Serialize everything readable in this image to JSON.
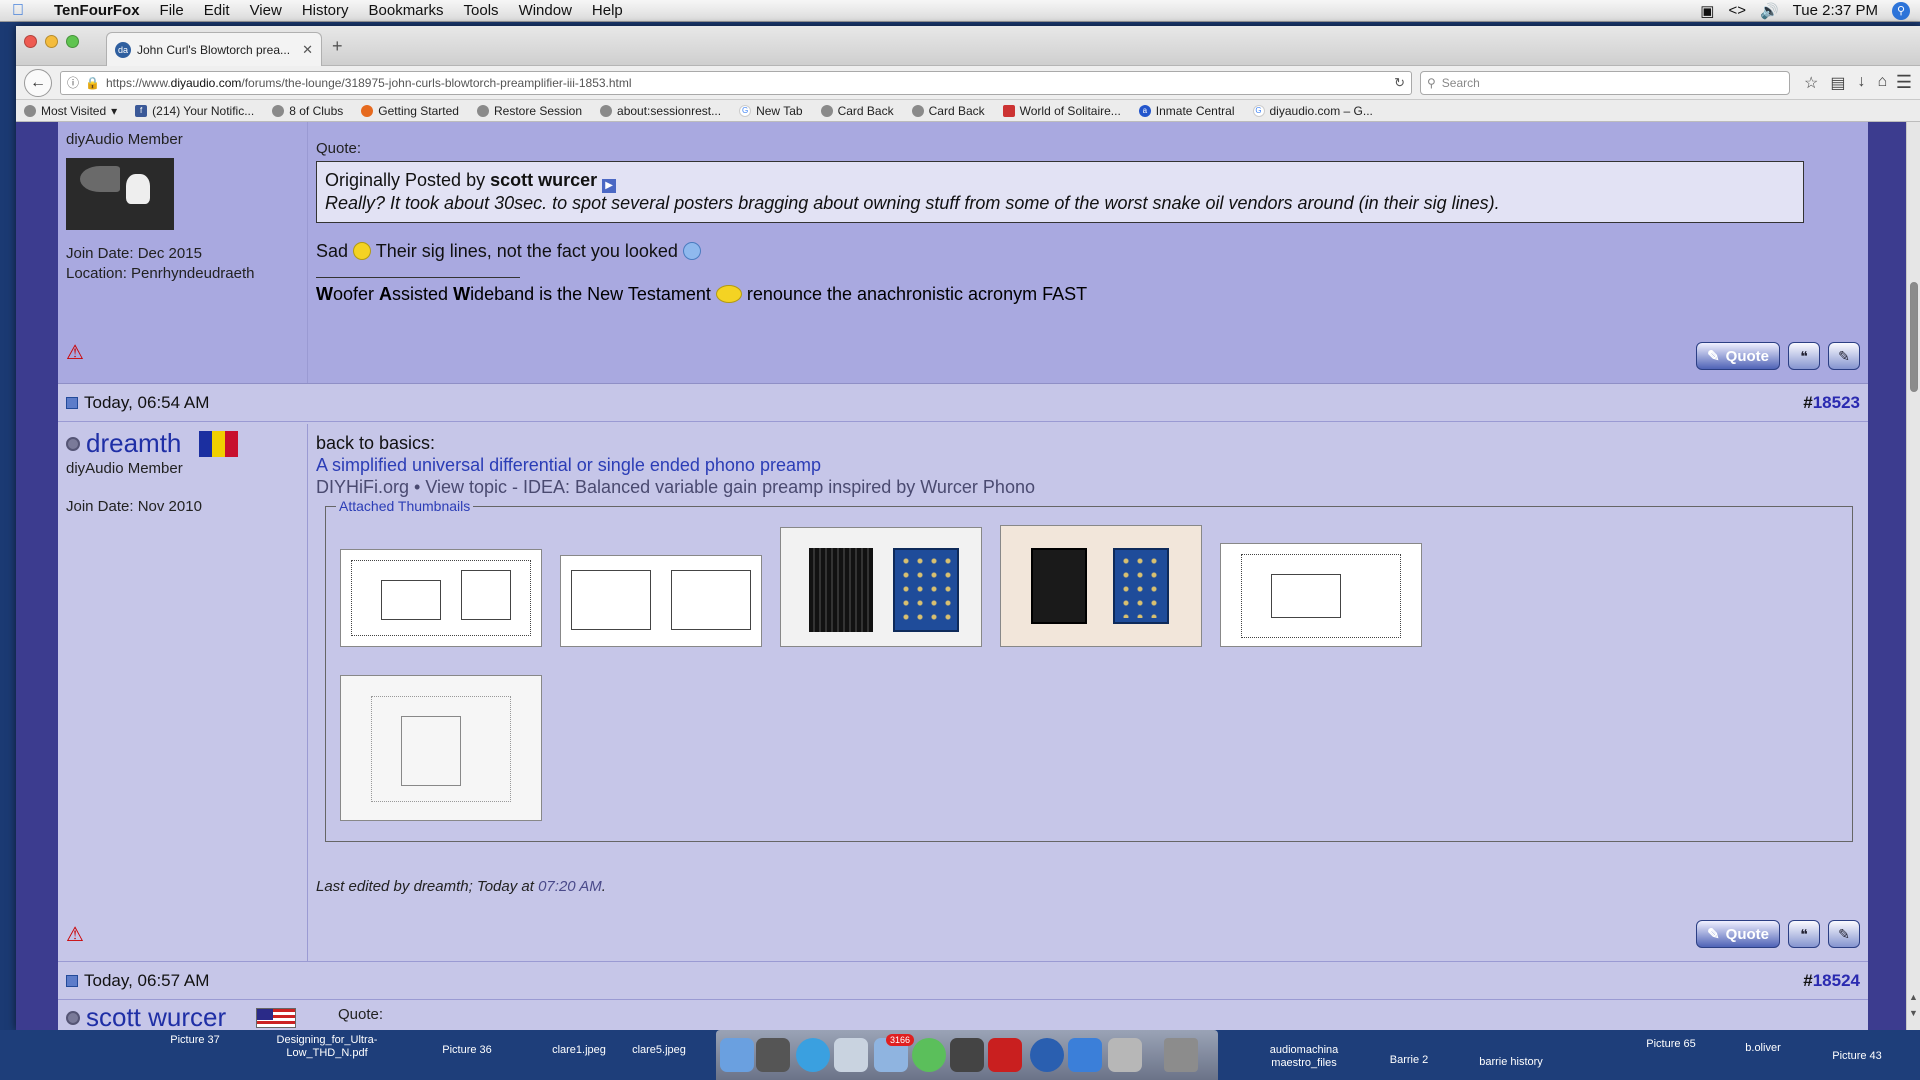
{
  "menubar": {
    "app_name": "TenFourFox",
    "items": [
      "File",
      "Edit",
      "View",
      "History",
      "Bookmarks",
      "Tools",
      "Window",
      "Help"
    ],
    "clock": "Tue 2:37 PM"
  },
  "browser": {
    "tab_title": "John Curl's Blowtorch prea...",
    "url_prefix": "https://www.",
    "url_domain": "diyaudio.com",
    "url_path": "/forums/the-lounge/318975-john-curls-blowtorch-preamplifier-iii-1853.html",
    "search_placeholder": "Search",
    "bookmarks": [
      "Most Visited",
      "(214) Your Notific...",
      "8 of Clubs",
      "Getting Started",
      "Restore Session",
      "about:sessionrest...",
      "New Tab",
      "Card Back",
      "Card Back",
      "World of Solitaire...",
      "Inmate Central",
      "diyaudio.com – G..."
    ]
  },
  "post1": {
    "member_title": "diyAudio Member",
    "join_date": "Join Date: Dec 2015",
    "location": "Location: Penrhyndeudraeth",
    "quote_label": "Quote:",
    "quote_prefix": "Originally Posted by",
    "quote_author": "scott wurcer",
    "quote_text": "Really? It took about 30sec. to spot several posters bragging about owning stuff from some of the worst snake oil vendors around (in their sig lines).",
    "text_a": "Sad",
    "text_b": "Their sig lines, not the fact you looked",
    "sig_w1b": "W",
    "sig_w1": "oofer ",
    "sig_w2b": "A",
    "sig_w2": "ssisted ",
    "sig_w3b": "W",
    "sig_w3": "ideband is the New Testament",
    "sig_end": "renounce the anachronistic acronym FAST",
    "quote_button": "Quote"
  },
  "post2_header": {
    "date": "Today, 06:54 AM",
    "hash": "#",
    "number": "18523"
  },
  "post2": {
    "username": "dreamth",
    "member_title": "diyAudio Member",
    "join_date": "Join Date: Nov 2010",
    "line1": "back to basics:",
    "link": "A simplified universal differential or single ended phono preamp",
    "line3": "DIYHiFi.org • View topic - IDEA: Balanced variable gain preamp inspired by Wurcer Phono",
    "attachments_label": "Attached Thumbnails",
    "edited_prefix": "Last edited by dreamth; Today at",
    "edited_time": "07:20 AM",
    "edited_suffix": ".",
    "quote_button": "Quote"
  },
  "post3_header": {
    "date": "Today, 06:57 AM",
    "hash": "#",
    "number": "18524"
  },
  "post3": {
    "username": "scott wurcer",
    "quote_label": "Quote:"
  },
  "dock": {
    "left_files": [
      "Picture 37",
      "Designing_for_Ultra-\nLow_THD_N.pdf",
      "Picture 36",
      "clare1.jpeg",
      "clare5.jpeg"
    ],
    "right_files": [
      "audiomachina\nmaestro_files",
      "Barrie 2",
      "barrie history",
      "Picture 65",
      "b.oliver",
      "Picture 43"
    ],
    "badge": "3166"
  }
}
